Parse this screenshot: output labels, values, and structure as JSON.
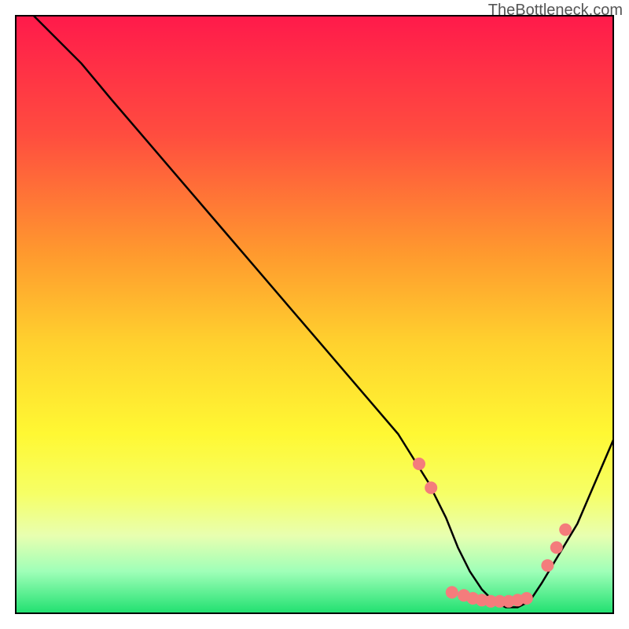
{
  "watermark": "TheBottleneck.com",
  "chart_data": {
    "type": "line",
    "title": "",
    "xlabel": "",
    "ylabel": "",
    "xlim": [
      0,
      100
    ],
    "ylim": [
      0,
      100
    ],
    "background_gradient": {
      "stops": [
        {
          "offset": 0,
          "color": "#ff1a4b"
        },
        {
          "offset": 20,
          "color": "#ff4d3f"
        },
        {
          "offset": 40,
          "color": "#ff9a2e"
        },
        {
          "offset": 55,
          "color": "#ffd22e"
        },
        {
          "offset": 70,
          "color": "#fff833"
        },
        {
          "offset": 80,
          "color": "#f6ff66"
        },
        {
          "offset": 87,
          "color": "#e8ffb0"
        },
        {
          "offset": 93,
          "color": "#9fffb8"
        },
        {
          "offset": 100,
          "color": "#20e070"
        }
      ]
    },
    "series": [
      {
        "name": "bottleneck-curve",
        "color": "#000000",
        "x": [
          3,
          11,
          16,
          22,
          28,
          34,
          40,
          46,
          52,
          58,
          64,
          69,
          72,
          74,
          76,
          78,
          80,
          82,
          84,
          86,
          88,
          94,
          100
        ],
        "y": [
          100,
          92,
          86,
          79,
          72,
          65,
          58,
          51,
          44,
          37,
          30,
          22,
          16,
          11,
          7,
          4,
          2,
          1,
          1,
          2,
          5,
          15,
          29
        ]
      }
    ],
    "markers": {
      "name": "highlighted-points",
      "color": "#f47c7c",
      "radius": 8,
      "points": [
        {
          "x": 67.5,
          "y": 25
        },
        {
          "x": 69.5,
          "y": 21
        },
        {
          "x": 73,
          "y": 3.5
        },
        {
          "x": 75,
          "y": 3
        },
        {
          "x": 76.5,
          "y": 2.5
        },
        {
          "x": 78,
          "y": 2.2
        },
        {
          "x": 79.5,
          "y": 2
        },
        {
          "x": 81,
          "y": 2
        },
        {
          "x": 82.5,
          "y": 2
        },
        {
          "x": 84,
          "y": 2.2
        },
        {
          "x": 85.5,
          "y": 2.5
        },
        {
          "x": 89,
          "y": 8
        },
        {
          "x": 90.5,
          "y": 11
        },
        {
          "x": 92,
          "y": 14
        }
      ]
    },
    "frame": {
      "color": "#000000",
      "width": 2
    }
  }
}
